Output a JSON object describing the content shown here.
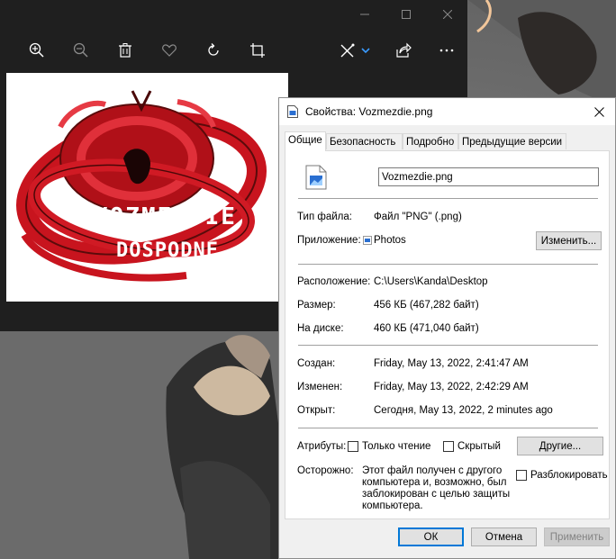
{
  "photos_app": {
    "image_text": {
      "line1": "VOZMEZDIE",
      "line2": "DOSPODNE"
    }
  },
  "dialog": {
    "title": "Свойства: Vozmezdie.png",
    "tabs": [
      "Общие",
      "Безопасность",
      "Подробно",
      "Предыдущие версии"
    ],
    "file_name": "Vozmezdie.png",
    "file_type_label": "Тип файла:",
    "file_type_value": "Файл \"PNG\" (.png)",
    "app_label": "Приложение:",
    "app_value": "Photos",
    "change_button": "Изменить...",
    "location_label": "Расположение:",
    "location_value": "C:\\Users\\Kanda\\Desktop",
    "size_label": "Размер:",
    "size_value": "456 КБ (467,282 байт)",
    "disk_label": "На диске:",
    "disk_value": "460 КБ (471,040 байт)",
    "created_label": "Создан:",
    "created_value": "Friday, May 13, 2022, 2:41:47 AM",
    "modified_label": "Изменен:",
    "modified_value": "Friday, May 13, 2022, 2:42:29 AM",
    "opened_label": "Открыт:",
    "opened_value": "Сегодня, May 13, 2022, 2 minutes ago",
    "attributes_label": "Атрибуты:",
    "readonly_label": "Только чтение",
    "hidden_label": "Скрытый",
    "other_button": "Другие...",
    "caution_label": "Осторожно:",
    "caution_text_1": "Этот файл получен с другого",
    "caution_text_2": "компьютера и, возможно, был",
    "caution_text_3": "заблокирован с целью защиты",
    "caution_text_4": "компьютера.",
    "unblock_label": "Разблокировать",
    "ok_button": "ОК",
    "cancel_button": "Отмена",
    "apply_button": "Применить"
  },
  "colors": {
    "photos_bg": "#1f1f1f",
    "image_red": "#c8141e",
    "dialog_bg": "#f0f0f0",
    "accent": "#0078d7"
  }
}
